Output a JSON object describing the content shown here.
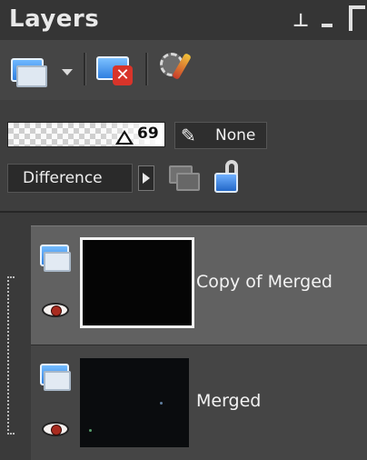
{
  "panel": {
    "title": "Layers",
    "pin_glyph": "⊥",
    "icons": [
      "pin-icon",
      "minimize-icon",
      "close-icon"
    ]
  },
  "toolbar": {
    "buttons": [
      {
        "name": "new-layer",
        "icon": "new-layer-icon"
      },
      {
        "name": "delete-layer",
        "icon": "delete-layer-icon"
      },
      {
        "name": "mask",
        "icon": "mask-icon"
      }
    ]
  },
  "opacity": {
    "value": "69",
    "level": 0.69,
    "link_label": "None"
  },
  "blend": {
    "mode": "Difference"
  },
  "layers": [
    {
      "name": "Copy of Merged",
      "selected": true,
      "visible": true
    },
    {
      "name": "Merged",
      "selected": false,
      "visible": true
    }
  ],
  "colors": {
    "panel_bg": "#3e3e3e",
    "selected_row": "#616161",
    "accent_blue": "#2f7fe0"
  }
}
